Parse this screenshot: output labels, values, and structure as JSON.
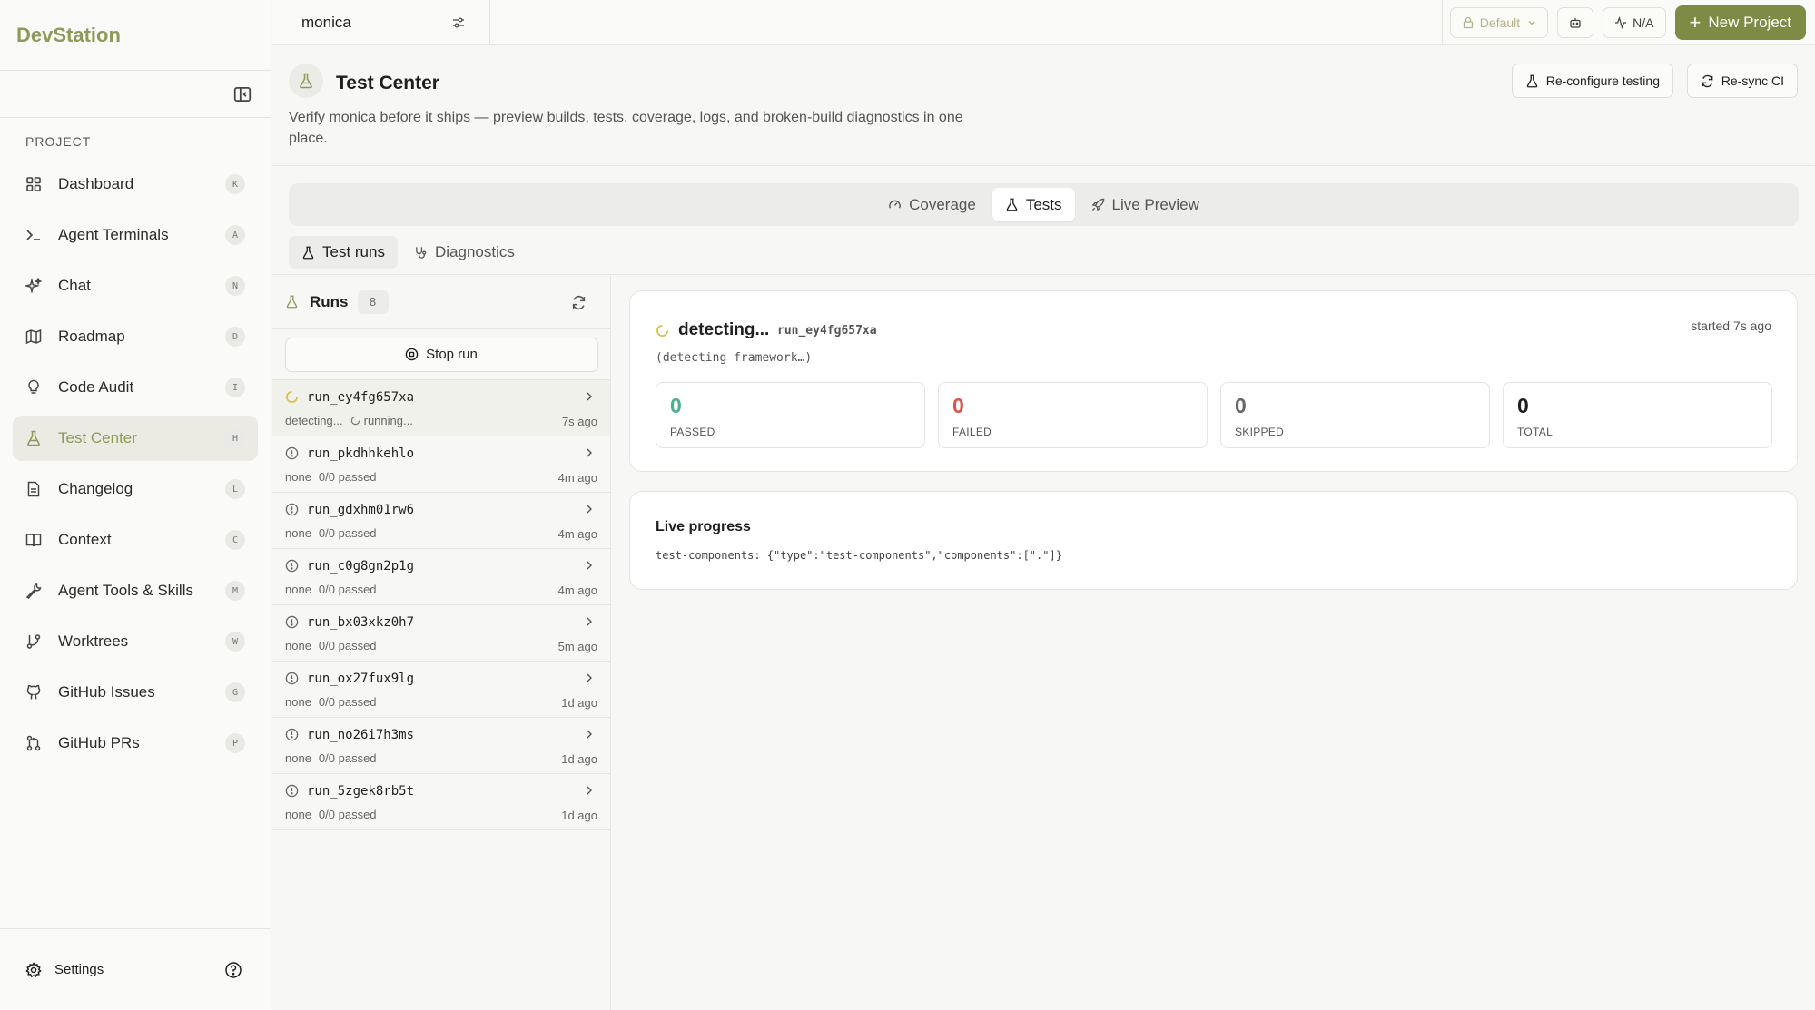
{
  "brand": "DevStation",
  "sidebar": {
    "section_label": "PROJECT",
    "items": [
      {
        "label": "Dashboard",
        "key": "K",
        "icon": "grid-icon"
      },
      {
        "label": "Agent Terminals",
        "key": "A",
        "icon": "terminal-icon"
      },
      {
        "label": "Chat",
        "key": "N",
        "icon": "sparkles-icon"
      },
      {
        "label": "Roadmap",
        "key": "D",
        "icon": "map-icon"
      },
      {
        "label": "Code Audit",
        "key": "I",
        "icon": "lightbulb-icon"
      },
      {
        "label": "Test Center",
        "key": "H",
        "icon": "flask-icon",
        "active": true
      },
      {
        "label": "Changelog",
        "key": "L",
        "icon": "document-icon"
      },
      {
        "label": "Context",
        "key": "C",
        "icon": "book-icon"
      },
      {
        "label": "Agent Tools & Skills",
        "key": "M",
        "icon": "wrench-icon"
      },
      {
        "label": "Worktrees",
        "key": "W",
        "icon": "git-branch-icon"
      },
      {
        "label": "GitHub Issues",
        "key": "G",
        "icon": "github-icon"
      },
      {
        "label": "GitHub PRs",
        "key": "P",
        "icon": "pull-request-icon"
      }
    ],
    "footer_settings": "Settings"
  },
  "topbar": {
    "workspace": "monica",
    "profile": "Default",
    "status": "N/A",
    "new_project": "New Project"
  },
  "header": {
    "title": "Test Center",
    "description": "Verify monica before it ships — preview builds, tests, coverage, logs, and broken-build diagnostics in one place.",
    "reconfigure": "Re-configure testing",
    "resync": "Re-sync CI"
  },
  "main_tabs": {
    "coverage": "Coverage",
    "tests": "Tests",
    "preview": "Live Preview"
  },
  "sub_tabs": {
    "runs": "Test runs",
    "diagnostics": "Diagnostics"
  },
  "runs": {
    "title": "Runs",
    "count": "8",
    "stop": "Stop run",
    "items": [
      {
        "id": "run_ey4fg657xa",
        "framework": "detecting...",
        "status": "running...",
        "age": "7s ago"
      },
      {
        "id": "run_pkdhhkehlo",
        "framework": "none",
        "status": "0/0 passed",
        "age": "4m ago"
      },
      {
        "id": "run_gdxhm01rw6",
        "framework": "none",
        "status": "0/0 passed",
        "age": "4m ago"
      },
      {
        "id": "run_c0g8gn2p1g",
        "framework": "none",
        "status": "0/0 passed",
        "age": "4m ago"
      },
      {
        "id": "run_bx03xkz0h7",
        "framework": "none",
        "status": "0/0 passed",
        "age": "5m ago"
      },
      {
        "id": "run_ox27fux9lg",
        "framework": "none",
        "status": "0/0 passed",
        "age": "1d ago"
      },
      {
        "id": "run_no26i7h3ms",
        "framework": "none",
        "status": "0/0 passed",
        "age": "1d ago"
      },
      {
        "id": "run_5zgek8rb5t",
        "framework": "none",
        "status": "0/0 passed",
        "age": "1d ago"
      }
    ]
  },
  "current": {
    "status": "detecting...",
    "id": "run_ey4fg657xa",
    "started": "started 7s ago",
    "framework": "(detecting framework…)",
    "stats": {
      "passed": "0",
      "passed_label": "PASSED",
      "failed": "0",
      "failed_label": "FAILED",
      "skipped": "0",
      "skipped_label": "SKIPPED",
      "total": "0",
      "total_label": "TOTAL"
    }
  },
  "live_progress": {
    "title": "Live progress",
    "line": "test-components: {\"type\":\"test-components\",\"components\":[\".\"]}"
  },
  "colors": {
    "accent": "#7d8b45",
    "brand": "#8d9a5a",
    "passed": "#4eae8f",
    "failed": "#d9534f",
    "running": "#d6c14c"
  }
}
